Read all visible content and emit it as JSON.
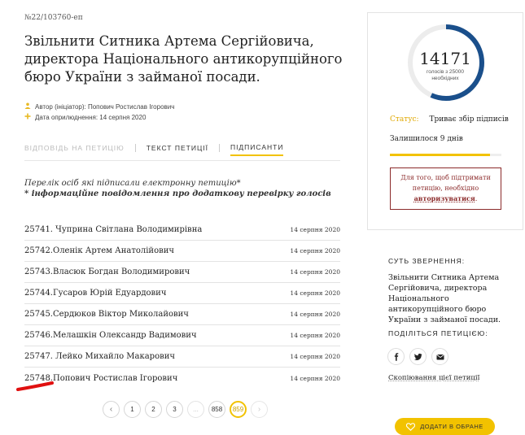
{
  "petition": {
    "number": "№22/103760-еп",
    "title": "Звільнити Ситника Артема Сергійовича, директора Національного антикорупційного бюро України з займаної посади.",
    "author": "Автор (ініціатор): Попович Ростислав Ігорович",
    "published": "Дата оприлюднення: 14 серпня 2020"
  },
  "tabs": [
    {
      "label": "ВІДПОВІДЬ НА ПЕТИЦІЮ"
    },
    {
      "label": "ТЕКСТ ПЕТИЦІЇ"
    },
    {
      "label": "ПІДПИСАНТИ"
    }
  ],
  "notes": {
    "line1": "Перелік осіб які підписали електронну петицію*",
    "line2": "* інформаційне повідомлення про додаткову перевірку голосів"
  },
  "signers": [
    {
      "name": "25741. Чуприна Світлана Володимирівна",
      "date": "14 серпня 2020"
    },
    {
      "name": "25742.Оленік Артем Анатолійович",
      "date": "14 серпня 2020"
    },
    {
      "name": "25743.Власюк Богдан Володимирович",
      "date": "14 серпня 2020"
    },
    {
      "name": "25744.Гусаров Юрій Едуардович",
      "date": "14 серпня 2020"
    },
    {
      "name": "25745.Сердюков Віктор Миколайович",
      "date": "14 серпня 2020"
    },
    {
      "name": "25746.Мелашкін Олександр Вадимович",
      "date": "14 серпня 2020"
    },
    {
      "name": "25747. Лейко Михайло Макарович",
      "date": "14 серпня 2020"
    },
    {
      "name": "25748.Попович Ростислав Ігорович",
      "date": "14 серпня 2020"
    }
  ],
  "pagination": {
    "prev": "‹",
    "pages": [
      "1",
      "2",
      "3"
    ],
    "ellipsis": "...",
    "last_prev": "858",
    "current": "859",
    "next": "›"
  },
  "votes": {
    "count": "14171",
    "target_line1": "голосів з 25000",
    "target_line2": "необхідних",
    "fraction": 0.567
  },
  "status": {
    "label": "Статус:",
    "value": "Триває збір підписів",
    "remaining": "Залишилося 9 днів",
    "time_progress": 0.9
  },
  "auth": {
    "text": "Для того, щоб підтримати петицію, необхідно",
    "link": "авторизуватися",
    "suffix": "."
  },
  "essence": {
    "heading": "СУТЬ ЗВЕРНЕННЯ:",
    "text": "Звільнити Ситника Артема Сергійовича, директора Національного антикорупційного бюро України з займаної посади."
  },
  "share": {
    "heading": "ПОДІЛІТЬСЯ ПЕТИЦІЄЮ:",
    "icons": [
      "facebook-icon",
      "twitter-icon",
      "email-icon"
    ],
    "copy": "Скопіювання цієї петиції"
  },
  "favorite": {
    "label": "ДОДАТИ В ОБРАНЕ",
    "icon": "heart-icon"
  },
  "colors": {
    "accent": "#f2c200",
    "gauge": "#1a4f8b",
    "auth": "#8b2a2a",
    "mark": "#e01010"
  }
}
